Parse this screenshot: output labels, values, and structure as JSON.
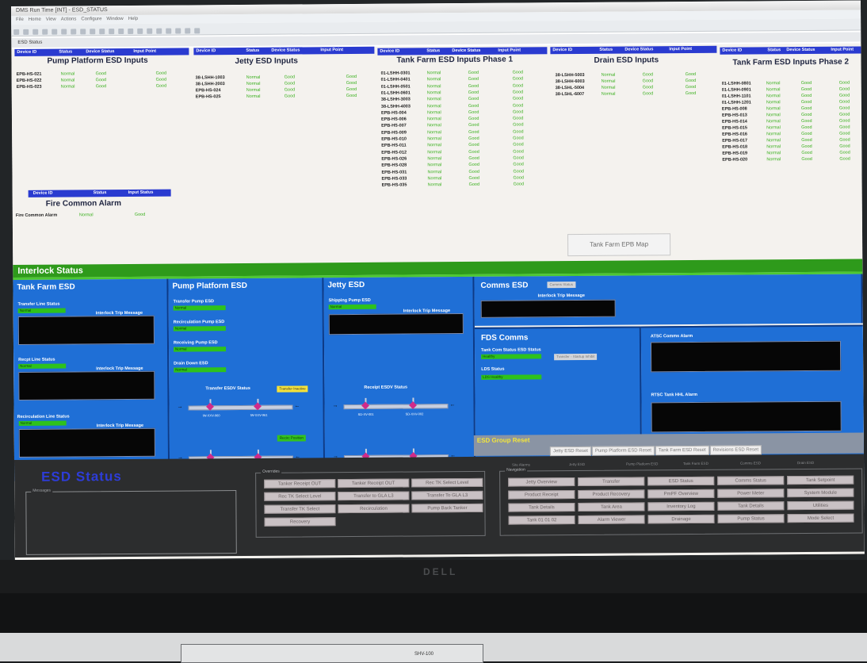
{
  "app": {
    "title": "DMS Run Time [INT] - ESD_STATUS",
    "menu": [
      "File",
      "Home",
      "View",
      "Actions",
      "Configure",
      "Window",
      "Help"
    ],
    "window_tab": "ESD Status"
  },
  "esd_inputs": {
    "headers": {
      "device_id": "Device ID",
      "status": "Status",
      "device_status": "Device Status",
      "input_point": "Input Point"
    },
    "pump_platform": {
      "title": "Pump Platform ESD Inputs",
      "rows": [
        {
          "id": "EPB-HS-021",
          "status": "Normal",
          "device_status": "Good",
          "input": "Good"
        },
        {
          "id": "EPB-HS-022",
          "status": "Normal",
          "device_status": "Good",
          "input": "Good"
        },
        {
          "id": "EPB-HS-023",
          "status": "Normal",
          "device_status": "Good",
          "input": "Good"
        }
      ]
    },
    "jetty": {
      "title": "Jetty ESD Inputs",
      "rows": [
        {
          "id": "38-LSHH-1003",
          "status": "Normal",
          "device_status": "Good",
          "input": "Good"
        },
        {
          "id": "38-LSHH-2003",
          "status": "Normal",
          "device_status": "Good",
          "input": "Good"
        },
        {
          "id": "EPB-HS-024",
          "status": "Normal",
          "device_status": "Good",
          "input": "Good"
        },
        {
          "id": "EPB-HS-025",
          "status": "Normal",
          "device_status": "Good",
          "input": "Good"
        }
      ]
    },
    "tank_farm_1": {
      "title": "Tank Farm ESD Inputs Phase 1",
      "rows": [
        {
          "id": "01-LSHH-0301",
          "status": "Normal",
          "device_status": "Good",
          "input": "Good"
        },
        {
          "id": "01-LSHH-0401",
          "status": "Normal",
          "device_status": "Good",
          "input": "Good"
        },
        {
          "id": "01-LSHH-0501",
          "status": "Normal",
          "device_status": "Good",
          "input": "Good"
        },
        {
          "id": "01-LSHH-0601",
          "status": "Normal",
          "device_status": "Good",
          "input": "Good"
        },
        {
          "id": "38-LSHH-3003",
          "status": "Normal",
          "device_status": "Good",
          "input": "Good"
        },
        {
          "id": "38-LSHH-4003",
          "status": "Normal",
          "device_status": "Good",
          "input": "Good"
        },
        {
          "id": "EPB-HS-004",
          "status": "Normal",
          "device_status": "Good",
          "input": "Good"
        },
        {
          "id": "EPB-HS-006",
          "status": "Normal",
          "device_status": "Good",
          "input": "Good"
        },
        {
          "id": "EPB-HS-007",
          "status": "Normal",
          "device_status": "Good",
          "input": "Good"
        },
        {
          "id": "EPB-HS-009",
          "status": "Normal",
          "device_status": "Good",
          "input": "Good"
        },
        {
          "id": "EPB-HS-010",
          "status": "Normal",
          "device_status": "Good",
          "input": "Good"
        },
        {
          "id": "EPB-HS-011",
          "status": "Normal",
          "device_status": "Good",
          "input": "Good"
        },
        {
          "id": "EPB-HS-012",
          "status": "Normal",
          "device_status": "Good",
          "input": "Good"
        },
        {
          "id": "EPB-HS-026",
          "status": "Normal",
          "device_status": "Good",
          "input": "Good"
        },
        {
          "id": "EPB-HS-028",
          "status": "Normal",
          "device_status": "Good",
          "input": "Good"
        },
        {
          "id": "EPB-HS-031",
          "status": "Normal",
          "device_status": "Good",
          "input": "Good"
        },
        {
          "id": "EPB-HS-033",
          "status": "Normal",
          "device_status": "Good",
          "input": "Good"
        },
        {
          "id": "EPB-HS-035",
          "status": "Normal",
          "device_status": "Good",
          "input": "Good"
        }
      ]
    },
    "drain": {
      "title": "Drain ESD Inputs",
      "rows": [
        {
          "id": "38-LSHH-5003",
          "status": "Normal",
          "device_status": "Good",
          "input": "Good"
        },
        {
          "id": "38-LSHH-6003",
          "status": "Normal",
          "device_status": "Good",
          "input": "Good"
        },
        {
          "id": "38-LSHL-5004",
          "status": "Normal",
          "device_status": "Good",
          "input": "Good"
        },
        {
          "id": "38-LSHL-6007",
          "status": "Normal",
          "device_status": "Good",
          "input": "Good"
        }
      ]
    },
    "tank_farm_2": {
      "title": "Tank Farm ESD Inputs Phase 2",
      "rows": [
        {
          "id": "01-LSHH-0801",
          "status": "Normal",
          "device_status": "Good",
          "input": "Good"
        },
        {
          "id": "01-LSHH-0901",
          "status": "Normal",
          "device_status": "Good",
          "input": "Good"
        },
        {
          "id": "01-LSHH-1101",
          "status": "Normal",
          "device_status": "Good",
          "input": "Good"
        },
        {
          "id": "01-LSHH-1201",
          "status": "Normal",
          "device_status": "Good",
          "input": "Good"
        },
        {
          "id": "EPB-HS-008",
          "status": "Normal",
          "device_status": "Good",
          "input": "Good"
        },
        {
          "id": "EPB-HS-013",
          "status": "Normal",
          "device_status": "Good",
          "input": "Good"
        },
        {
          "id": "EPB-HS-014",
          "status": "Normal",
          "device_status": "Good",
          "input": "Good"
        },
        {
          "id": "EPB-HS-015",
          "status": "Normal",
          "device_status": "Good",
          "input": "Good"
        },
        {
          "id": "EPB-HS-016",
          "status": "Normal",
          "device_status": "Good",
          "input": "Good"
        },
        {
          "id": "EPB-HS-017",
          "status": "Normal",
          "device_status": "Good",
          "input": "Good"
        },
        {
          "id": "EPB-HS-018",
          "status": "Normal",
          "device_status": "Good",
          "input": "Good"
        },
        {
          "id": "EPB-HS-019",
          "status": "Normal",
          "device_status": "Good",
          "input": "Good"
        },
        {
          "id": "EPB-HS-020",
          "status": "Normal",
          "device_status": "Good",
          "input": "Good"
        }
      ]
    },
    "fire": {
      "headers": {
        "device_id": "Device ID",
        "status": "Status",
        "input_status": "Input Status"
      },
      "title": "Fire Common Alarm",
      "row": {
        "id": "Fire Common Alarm",
        "status": "Normal",
        "input": "Good"
      }
    },
    "map_button": "Tank Farm EPB Map"
  },
  "interlock": {
    "title": "Interlock Status",
    "tank_farm": {
      "title": "Tank Farm ESD",
      "transfer_label": "Transfer Line Status",
      "transfer_value": "Normal",
      "receipt_label": "Recpt Line Status",
      "receipt_value": "Normal",
      "recirc_label": "Recirculation Line Status",
      "recirc_value": "Normal",
      "msg_label": "Interlock Trip Message"
    },
    "pump_platform": {
      "title": "Pump Platform ESD",
      "items": [
        {
          "label": "Transfer Pump ESD",
          "value": "Normal"
        },
        {
          "label": "Recirculation Pump ESD",
          "value": "Normal"
        },
        {
          "label": "Receiving Pump ESD",
          "value": "Normal"
        },
        {
          "label": "Drain Down ESD",
          "value": "Normal"
        }
      ],
      "esdv_label": "Transfer ESDV Status",
      "transfer_state": "Transfer Inactive",
      "recirc_state": "Recirc Position",
      "valves_top": [
        "IW-XXV-960",
        "IW-XXV-961"
      ],
      "valves_bottom": [
        "IW-XXV-962",
        "IW-XXV-963"
      ]
    },
    "jetty": {
      "title": "Jetty ESD",
      "shipping_label": "Shipping Pump ESD",
      "shipping_value": "Normal",
      "msg_label": "Interlock Trip Message",
      "esdv_label": "Receipt ESDV Status",
      "valves_top": [
        "SD-XV-001",
        "SD-XXV-002"
      ],
      "valves_bottom": [
        "SD-XV-003",
        "SD-XXV-004"
      ]
    },
    "comms": {
      "title": "Comms ESD",
      "badge": "Comms Status",
      "msg_label": "Interlock Trip Message"
    },
    "fds": {
      "title": "FDS Comms",
      "tank_label": "Tank Com Status ESD Status",
      "tank_value": "Healthy",
      "transfer_btn": "Transfer - Startup Inhibit",
      "lds_label": "LDS Status",
      "lds_value": "LDS Healthy"
    },
    "atsc_label": "ATSC Comms Alarm",
    "rtsc_label": "RTSC Tank HHL Alarm"
  },
  "group_reset": {
    "title": "ESD Group Reset",
    "buttons": [
      "Jetty ESD Reset",
      "Pump Platform ESD Reset",
      "Tank Farm ESD Reset",
      "Revisions ESD Reset"
    ]
  },
  "bottom": {
    "esd_status": "ESD Status",
    "messages_label": "Messages",
    "overrides_label": "Overrides",
    "override_buttons": [
      "Tanker Receipt OUT",
      "Tanker Receipt OUT",
      "Rec TK Select Level",
      "Rec TK Select Level",
      "Transfer to GLA L3",
      "Transfer To GLA L3",
      "Transfer TK Select",
      "Recirculation",
      "Pump Back Tanker",
      "Recovery"
    ],
    "nav_label": "Navigation",
    "nav_headers": [
      "Site Alarms",
      "Jetty ESD",
      "Pump Platform ESD",
      "Tank Farm ESD",
      "Comms ESD",
      "Drain ESD"
    ],
    "nav_buttons": [
      "Jetty Overview",
      "Transfer",
      "ESD Status",
      "Comms Status",
      "Tank Setpoint",
      "Product Receipt",
      "Product Recovery",
      "PmPF Overview",
      "Power Meter",
      "System Module",
      "Tank Details",
      "Tank Area",
      "Inventory Log",
      "Tank Details",
      "Utilities",
      "Tank 01 01 02",
      "Alarm Viewer",
      "Drainage",
      "Pump Status",
      "Mode Select"
    ]
  },
  "monitor": {
    "brand": "DELL"
  },
  "desk": {
    "label": "SHV-100"
  }
}
